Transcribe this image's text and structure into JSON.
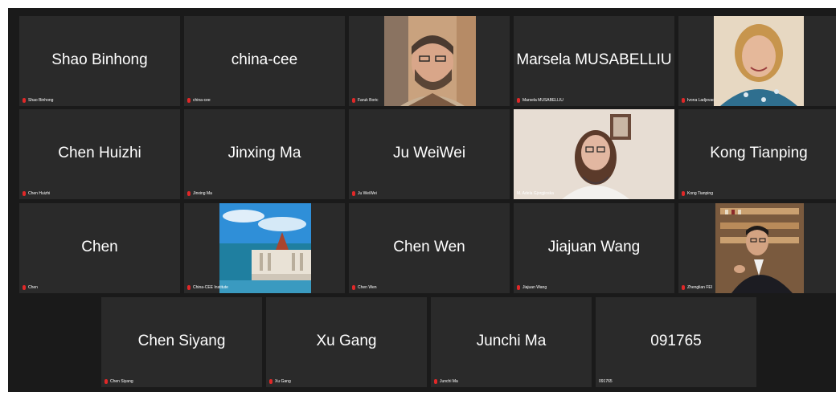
{
  "meeting": {
    "rows": [
      [
        {
          "name": "Shao Binhong",
          "label": "Shao Binhong",
          "video": false
        },
        {
          "name": "china-cee",
          "label": "china-cee",
          "video": false
        },
        {
          "name": "",
          "label": "Faruk Boric",
          "video": true,
          "scene": "man-beard"
        },
        {
          "name": "Marsela MUSABELLIU",
          "label": "Marsela MUSABELLIU",
          "video": false
        },
        {
          "name": "",
          "label": "Ivona Ladjevac",
          "video": true,
          "scene": "woman-smile"
        }
      ],
      [
        {
          "name": "Chen Huizhi",
          "label": "Chen Huizhi",
          "video": false
        },
        {
          "name": "Jinxing Ma",
          "label": "Jinxing Ma",
          "video": false
        },
        {
          "name": "Ju WeiWei",
          "label": "Ju WeiWei",
          "video": false
        },
        {
          "name": "",
          "label": "M. Adela Gjorgjioska",
          "video": true,
          "scene": "woman-room",
          "active": true
        },
        {
          "name": "Kong Tianping",
          "label": "Kong Tianping",
          "video": false
        }
      ],
      [
        {
          "name": "Chen",
          "label": "Chen",
          "video": false
        },
        {
          "name": "",
          "label": "China-CEE Institute",
          "video": true,
          "scene": "parliament"
        },
        {
          "name": "Chen Wen",
          "label": "Chen Wen",
          "video": false
        },
        {
          "name": "Jiajuan Wang",
          "label": "Jiajuan Wang",
          "video": false
        },
        {
          "name": "",
          "label": "Zhenglian FEI",
          "video": true,
          "scene": "man-library"
        }
      ],
      [
        {
          "name": "Chen Siyang",
          "label": "Chen Siyang",
          "video": false
        },
        {
          "name": "Xu Gang",
          "label": "Xu Gang",
          "video": false
        },
        {
          "name": "Junchi Ma",
          "label": "Junchi Ma",
          "video": false
        },
        {
          "name": "091765",
          "label": "091765",
          "video": false
        }
      ]
    ]
  },
  "colors": {
    "background": "#1a1a1a",
    "tile": "#2a2a2a",
    "active_speaker": "#33c24a",
    "mic_muted": "#e02828"
  },
  "icons": {
    "muted_mic": "mic-muted-icon"
  }
}
